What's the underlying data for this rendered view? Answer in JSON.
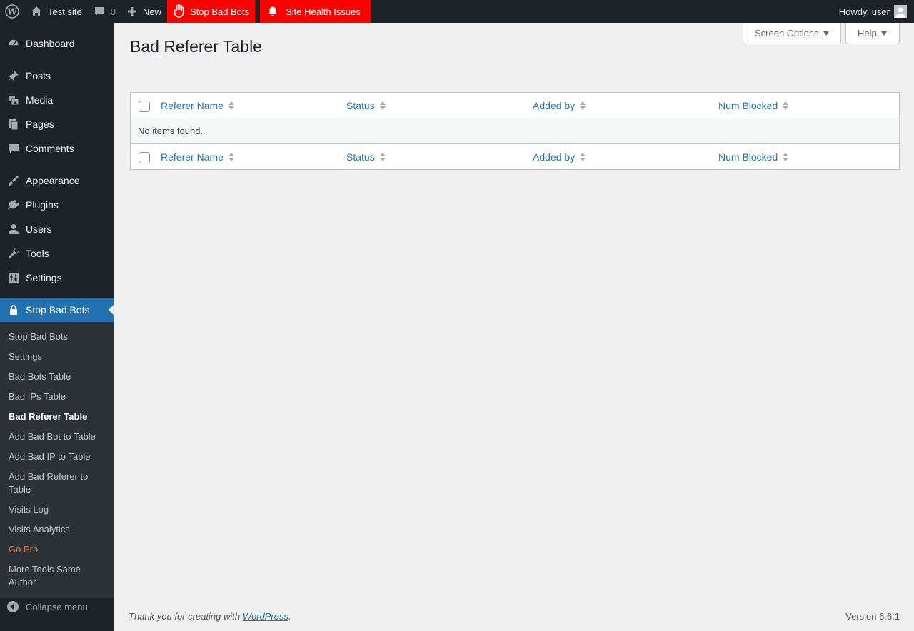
{
  "adminbar": {
    "site_name": "Test site",
    "comments_count": "0",
    "new_label": "New",
    "stop_bad_bots_label": "Stop Bad Bots",
    "site_health_label": "Site Health Issues",
    "howdy": "Howdy, user",
    "alert_color": "#ff0000"
  },
  "sidebar": {
    "items": [
      {
        "label": "Dashboard",
        "icon": "dashboard-icon"
      },
      {
        "label": "Posts",
        "icon": "pin-icon"
      },
      {
        "label": "Media",
        "icon": "media-icon"
      },
      {
        "label": "Pages",
        "icon": "pages-icon"
      },
      {
        "label": "Comments",
        "icon": "comment-icon"
      },
      {
        "label": "Appearance",
        "icon": "brush-icon"
      },
      {
        "label": "Plugins",
        "icon": "plugin-icon"
      },
      {
        "label": "Users",
        "icon": "user-icon"
      },
      {
        "label": "Tools",
        "icon": "wrench-icon"
      },
      {
        "label": "Settings",
        "icon": "settings-icon"
      },
      {
        "label": "Stop Bad Bots",
        "icon": "lock-icon"
      }
    ],
    "submenu": [
      "Stop Bad Bots",
      "Settings",
      "Bad Bots Table",
      "Bad IPs Table",
      "Bad Referer Table",
      "Add Bad Bot to Table",
      "Add Bad IP to Table",
      "Add Bad Referer to Table",
      "Visits Log",
      "Visits Analytics",
      "Go Pro",
      "More Tools Same Author"
    ],
    "collapse_label": "Collapse menu",
    "accent_color": "#2271b1",
    "gopro_color": "#f56e28"
  },
  "screen_options_label": "Screen Options",
  "help_label": "Help",
  "page_title": "Bad Referer Table",
  "table": {
    "columns": [
      "Referer Name",
      "Status",
      "Added by",
      "Num Blocked"
    ],
    "empty_message": "No items found."
  },
  "footer": {
    "thanks_prefix": "Thank you for creating with ",
    "wordpress_link": "WordPress",
    "thanks_suffix": ".",
    "version": "Version 6.6.1"
  }
}
